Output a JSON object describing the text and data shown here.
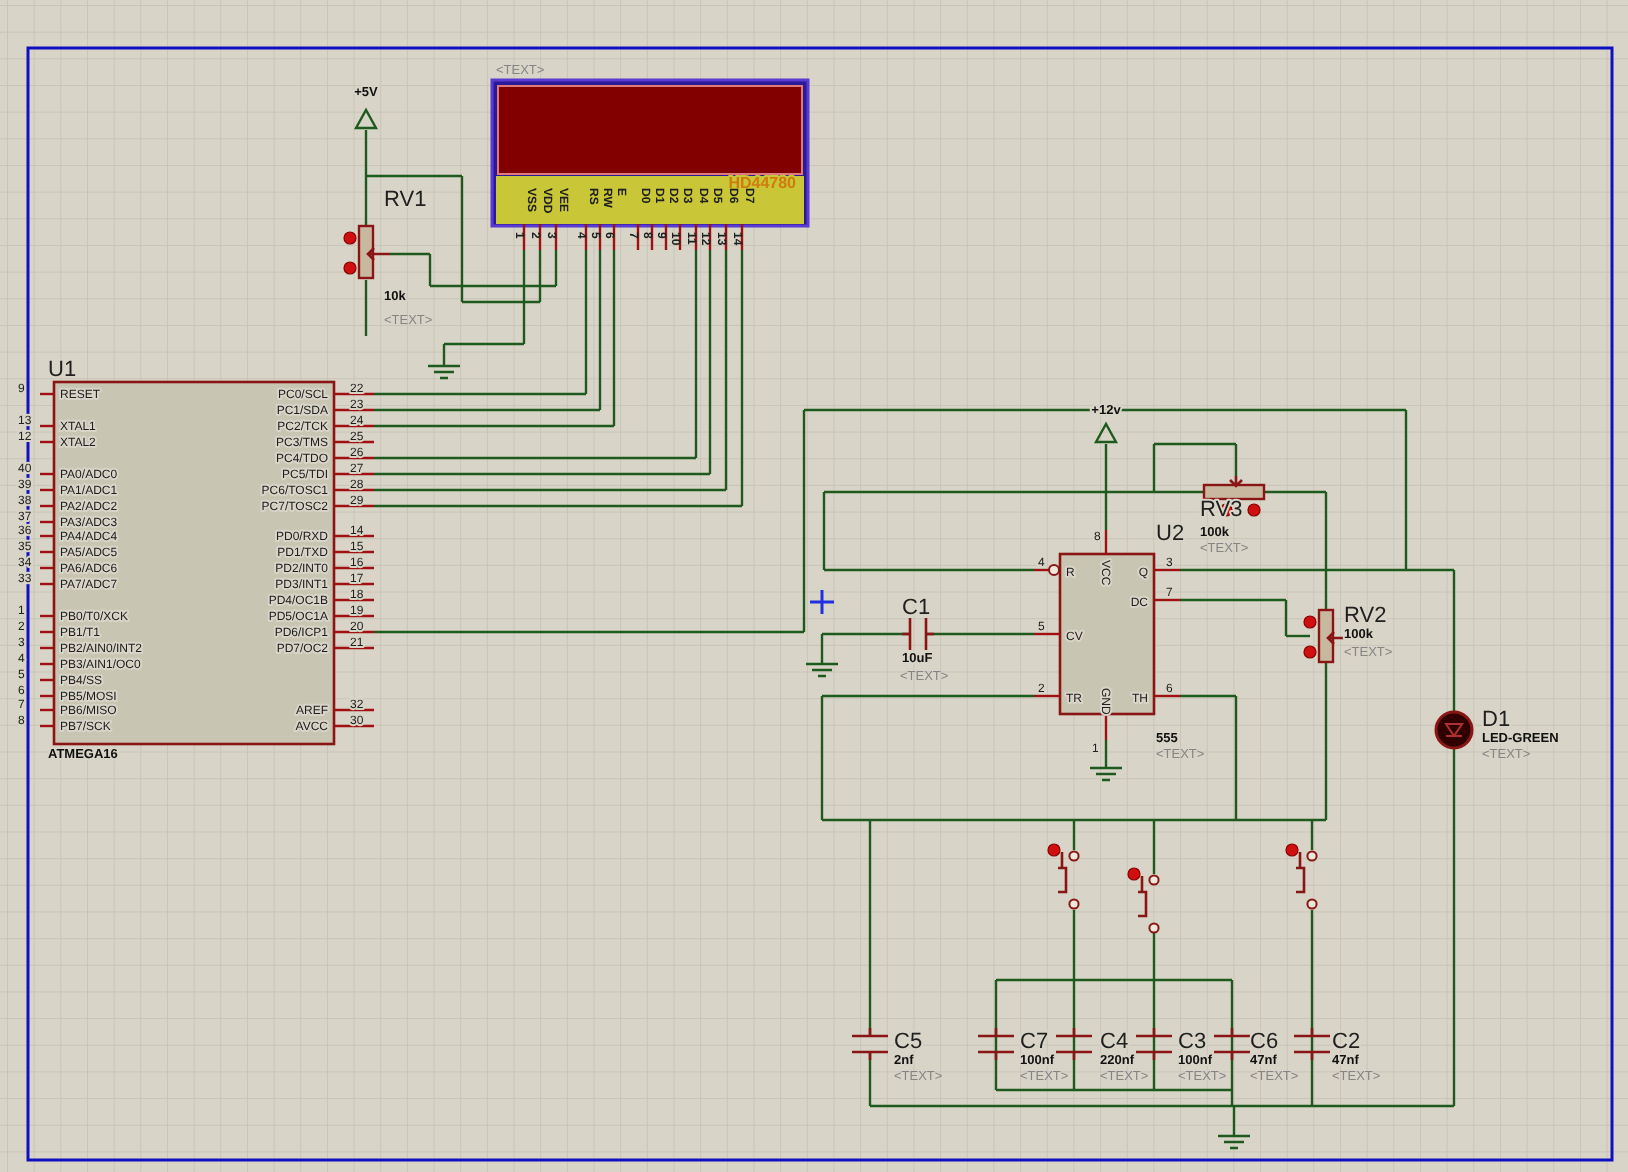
{
  "power_terminals": [
    {
      "label": "+5V"
    },
    {
      "label": "+12v"
    }
  ],
  "lcd": {
    "tag": "<TEXT>",
    "model": "HD44780",
    "pins": [
      {
        "name": "VSS",
        "number": "1"
      },
      {
        "name": "VDD",
        "number": "2"
      },
      {
        "name": "VEE",
        "number": "3"
      },
      {
        "name": "RS",
        "number": "4"
      },
      {
        "name": "RW",
        "number": "5"
      },
      {
        "name": "E",
        "number": "6"
      },
      {
        "name": "D0",
        "number": "7"
      },
      {
        "name": "D1",
        "number": "8"
      },
      {
        "name": "D2",
        "number": "9"
      },
      {
        "name": "D3",
        "number": "10"
      },
      {
        "name": "D4",
        "number": "11"
      },
      {
        "name": "D5",
        "number": "12"
      },
      {
        "name": "D6",
        "number": "13"
      },
      {
        "name": "D7",
        "number": "14"
      }
    ]
  },
  "u1": {
    "ref": "U1",
    "part": "ATMEGA16",
    "left_pins": [
      {
        "name": "RESET",
        "number": "9"
      },
      {
        "name": "XTAL1",
        "number": "13"
      },
      {
        "name": "XTAL2",
        "number": "12"
      },
      {
        "name": "PA0/ADC0",
        "number": "40"
      },
      {
        "name": "PA1/ADC1",
        "number": "39"
      },
      {
        "name": "PA2/ADC2",
        "number": "38"
      },
      {
        "name": "PA3/ADC3",
        "number": "37"
      },
      {
        "name": "PA4/ADC4",
        "number": "36"
      },
      {
        "name": "PA5/ADC5",
        "number": "35"
      },
      {
        "name": "PA6/ADC6",
        "number": "34"
      },
      {
        "name": "PA7/ADC7",
        "number": "33"
      },
      {
        "name": "PB0/T0/XCK",
        "number": "1"
      },
      {
        "name": "PB1/T1",
        "number": "2"
      },
      {
        "name": "PB2/AIN0/INT2",
        "number": "3"
      },
      {
        "name": "PB3/AIN1/OC0",
        "number": "4"
      },
      {
        "name": "PB4/SS",
        "number": "5"
      },
      {
        "name": "PB5/MOSI",
        "number": "6"
      },
      {
        "name": "PB6/MISO",
        "number": "7"
      },
      {
        "name": "PB7/SCK",
        "number": "8"
      }
    ],
    "right_pins": [
      {
        "name": "PC0/SCL",
        "number": "22"
      },
      {
        "name": "PC1/SDA",
        "number": "23"
      },
      {
        "name": "PC2/TCK",
        "number": "24"
      },
      {
        "name": "PC3/TMS",
        "number": "25"
      },
      {
        "name": "PC4/TDO",
        "number": "26"
      },
      {
        "name": "PC5/TDI",
        "number": "27"
      },
      {
        "name": "PC6/TOSC1",
        "number": "28"
      },
      {
        "name": "PC7/TOSC2",
        "number": "29"
      },
      {
        "name": "PD0/RXD",
        "number": "14"
      },
      {
        "name": "PD1/TXD",
        "number": "15"
      },
      {
        "name": "PD2/INT0",
        "number": "16"
      },
      {
        "name": "PD3/INT1",
        "number": "17"
      },
      {
        "name": "PD4/OC1B",
        "number": "18"
      },
      {
        "name": "PD5/OC1A",
        "number": "19"
      },
      {
        "name": "PD6/ICP1",
        "number": "20"
      },
      {
        "name": "PD7/OC2",
        "number": "21"
      },
      {
        "name": "AREF",
        "number": "32"
      },
      {
        "name": "AVCC",
        "number": "30"
      }
    ]
  },
  "u2": {
    "ref": "U2",
    "part": "555",
    "tag": "<TEXT>",
    "pins": [
      {
        "name": "R",
        "number": "4"
      },
      {
        "name": "VCC",
        "number": "8"
      },
      {
        "name": "Q",
        "number": "3"
      },
      {
        "name": "DC",
        "number": "7"
      },
      {
        "name": "CV",
        "number": "5"
      },
      {
        "name": "TR",
        "number": "2"
      },
      {
        "name": "GND",
        "number": "1"
      },
      {
        "name": "TH",
        "number": "6"
      }
    ]
  },
  "parts": [
    {
      "kind": "pot",
      "ref": "RV1",
      "value": "10k",
      "tag": "<TEXT>"
    },
    {
      "kind": "capacitor_h",
      "ref": "C1",
      "value": "10uF",
      "tag": "<TEXT>"
    },
    {
      "kind": "pot_h",
      "ref": "RV3",
      "value": "100k",
      "tag": "<TEXT>"
    },
    {
      "kind": "pot",
      "ref": "RV2",
      "value": "100k",
      "tag": "<TEXT>"
    },
    {
      "kind": "led",
      "ref": "D1",
      "value": "LED-GREEN",
      "tag": "<TEXT>"
    },
    {
      "kind": "capacitor",
      "ref": "C5",
      "value": "2nf",
      "tag": "<TEXT>"
    },
    {
      "kind": "capacitor",
      "ref": "C7",
      "value": "100nf",
      "tag": "<TEXT>"
    },
    {
      "kind": "capacitor",
      "ref": "C4",
      "value": "220nf",
      "tag": "<TEXT>"
    },
    {
      "kind": "capacitor",
      "ref": "C3",
      "value": "100nf",
      "tag": "<TEXT>"
    },
    {
      "kind": "capacitor",
      "ref": "C6",
      "value": "47nf",
      "tag": "<TEXT>"
    },
    {
      "kind": "capacitor",
      "ref": "C2",
      "value": "47nf",
      "tag": "<TEXT>"
    }
  ]
}
